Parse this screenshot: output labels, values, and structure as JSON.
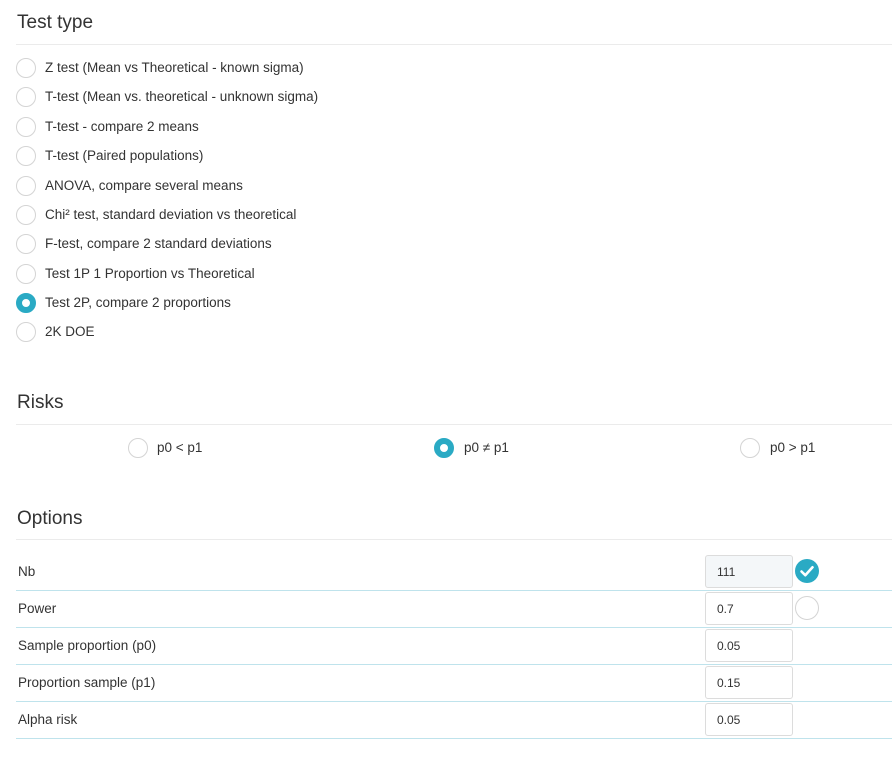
{
  "test_type": {
    "title": "Test type",
    "selected": "Test 2P, compare 2 proportions",
    "options": [
      {
        "label": "Z test (Mean vs Theoretical - known sigma)",
        "checked": false
      },
      {
        "label": "T-test (Mean vs. theoretical - unknown sigma)",
        "checked": false
      },
      {
        "label": "T-test - compare 2 means",
        "checked": false
      },
      {
        "label": "T-test (Paired populations)",
        "checked": false
      },
      {
        "label": "ANOVA, compare several means",
        "checked": false
      },
      {
        "label": "Chi² test, standard deviation vs theoretical",
        "checked": false
      },
      {
        "label": "F-test, compare 2 standard deviations",
        "checked": false
      },
      {
        "label": "Test 1P 1 Proportion vs Theoretical",
        "checked": false
      },
      {
        "label": "Test 2P, compare 2 proportions",
        "checked": true
      },
      {
        "label": "2K DOE",
        "checked": false
      }
    ]
  },
  "risks": {
    "title": "Risks",
    "selected": "p0 ≠ p1",
    "options": [
      {
        "label": "p0 < p1",
        "checked": false
      },
      {
        "label": "p0 ≠ p1",
        "checked": true
      },
      {
        "label": "p0 > p1",
        "checked": false
      }
    ]
  },
  "options": {
    "title": "Options",
    "rows": [
      {
        "label": "Nb",
        "value": "111",
        "computed": true,
        "has_toggle": true,
        "toggle_icon": "check-icon"
      },
      {
        "label": "Power",
        "value": "0.7",
        "computed": false,
        "has_toggle": true,
        "toggle_icon": "empty-circle-icon"
      },
      {
        "label": "Sample proportion (p0)",
        "value": "0.05",
        "computed": false,
        "has_toggle": false
      },
      {
        "label": "Proportion sample (p1)",
        "value": "0.15",
        "computed": false,
        "has_toggle": false
      },
      {
        "label": "Alpha risk",
        "value": "0.05",
        "computed": false,
        "has_toggle": false
      }
    ]
  },
  "colors": {
    "accent": "#2aaac4",
    "row_divider": "#bfe3ec",
    "radio_border": "#d4d4d4"
  }
}
